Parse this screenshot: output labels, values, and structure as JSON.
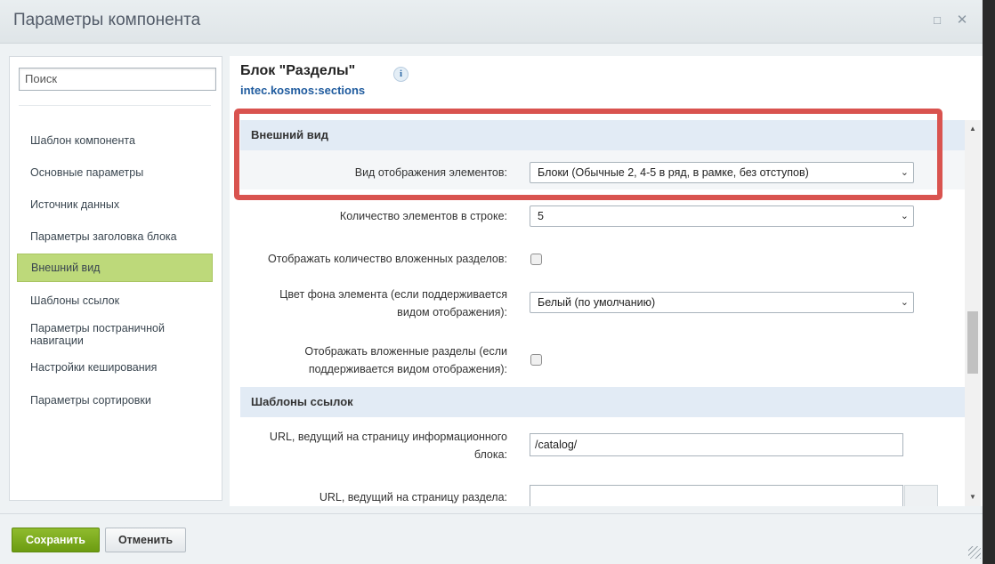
{
  "dialog": {
    "title": "Параметры компонента",
    "expand_icon": "□",
    "close_icon": "✕"
  },
  "sidebar": {
    "search_placeholder": "Поиск",
    "items": [
      {
        "label": "Шаблон компонента"
      },
      {
        "label": "Основные параметры"
      },
      {
        "label": "Источник данных"
      },
      {
        "label": "Параметры заголовка блока"
      },
      {
        "label": "Внешний вид",
        "active": true
      },
      {
        "label": "Шаблоны ссылок"
      },
      {
        "label": "Параметры постраничной навигации"
      },
      {
        "label": "Настройки кеширования"
      },
      {
        "label": "Параметры сортировки"
      }
    ]
  },
  "block": {
    "title": "Блок \"Разделы\"",
    "info_icon": "i",
    "code": "intec.kosmos:sections"
  },
  "sections": {
    "appearance": {
      "title": "Внешний вид",
      "view_label": "Вид отображения элементов:",
      "view_value": "Блоки (Обычные 2, 4-5 в ряд, в рамке, без отступов)",
      "count_label": "Количество элементов в строке:",
      "count_value": "5",
      "show_count_label": "Отображать количество вложенных разделов:",
      "show_count_checked": false,
      "bg_label_1": "Цвет фона элемента (если поддерживается",
      "bg_label_2": "видом отображения):",
      "bg_value": "Белый (по умолчанию)",
      "show_sub_label_1": "Отображать вложенные разделы (если",
      "show_sub_label_2": "поддерживается видом отображения):",
      "show_sub_checked": false
    },
    "links": {
      "title": "Шаблоны ссылок",
      "iblock_url_label_1": "URL, ведущий на страницу информационного",
      "iblock_url_label_2": "блока:",
      "iblock_url_value": "/catalog/",
      "section_url_label": "URL, ведущий на страницу раздела:",
      "section_url_value": ""
    }
  },
  "icons": {
    "dropdown": "chevron-down-icon",
    "select_arrow": "⌄",
    "scroll_up": "▲",
    "scroll_down": "▼"
  },
  "highlight_color": "#d9534f",
  "footer": {
    "save_label": "Сохранить",
    "cancel_label": "Отменить"
  }
}
